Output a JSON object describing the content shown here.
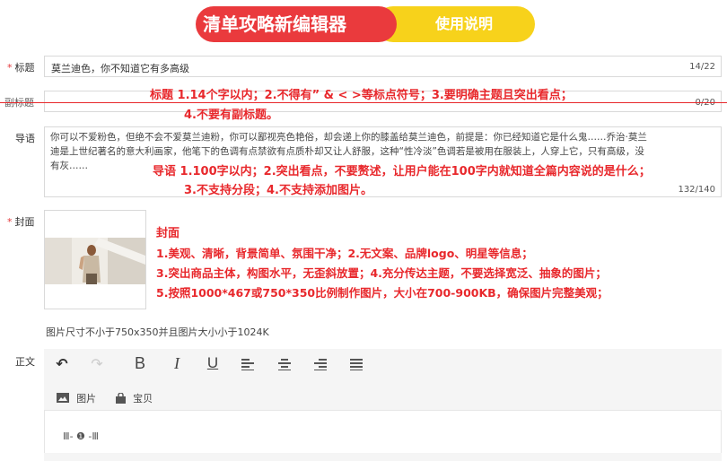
{
  "header": {
    "title": "清单攻略新编辑器",
    "help_label": "使用说明"
  },
  "fields": {
    "title": {
      "label": "标题",
      "value": "莫兰迪色，你不知道它有多高级",
      "count": "14/22"
    },
    "subtitle": {
      "label": "副标题",
      "count": "0/20"
    },
    "intro": {
      "label": "导语",
      "lines": [
        "你可以不爱粉色，但绝不会不爱莫兰迪粉，你可以鄙视亮色艳俗，却会递上你的膝盖给莫兰迪色，前提是：你已经知道它是什么鬼……乔治·莫兰",
        "迪是上世纪著名的意大利画家，他笔下的色调有点禁欲有点质朴却又让人舒服，这种“性冷淡”色调若是被用在服装上，人穿上它，只有高级，没",
        "有灰……"
      ],
      "count": "132/140"
    },
    "cover": {
      "label": "封面",
      "hint": "图片尺寸不小于750x350并且图片大小小于1024K"
    },
    "body": {
      "label": "正文",
      "image_label": "图片",
      "item_label": "宝贝",
      "content": "Ⅲ- ❶ -Ⅲ"
    }
  },
  "annotations": {
    "title_rules": [
      "标题 1.14个字以内；2.不得有” & < >等标点符号；3.要明确主题且突出看点；",
      "4.不要有副标题。"
    ],
    "intro_rules": [
      "导语 1.100字以内；2.突出看点，不要赘述，让用户能在100字内就知道全篇内容说的是什么；",
      "3.不支持分段；4.不支持添加图片。"
    ],
    "cover_rules": [
      "封面",
      "1.美观、清晰，背景简单、氛围干净；2.无文案、品牌logo、明星等信息；",
      "3.突出商品主体，构图水平，无歪斜放置；4.充分传达主题，不要选择宽泛、抽象的图片；",
      "5.按照1000*467或750*350比例制作图片，大小在700-900KB，确保图片完整美观；"
    ]
  },
  "toolbar": {
    "undo": "↶",
    "redo": "↷",
    "bold": "B",
    "italic": "I",
    "underline": "U"
  },
  "colors": {
    "brand_red": "#ea3a3d",
    "brand_yellow": "#f7d21b",
    "annotation_red": "#e8282c"
  }
}
